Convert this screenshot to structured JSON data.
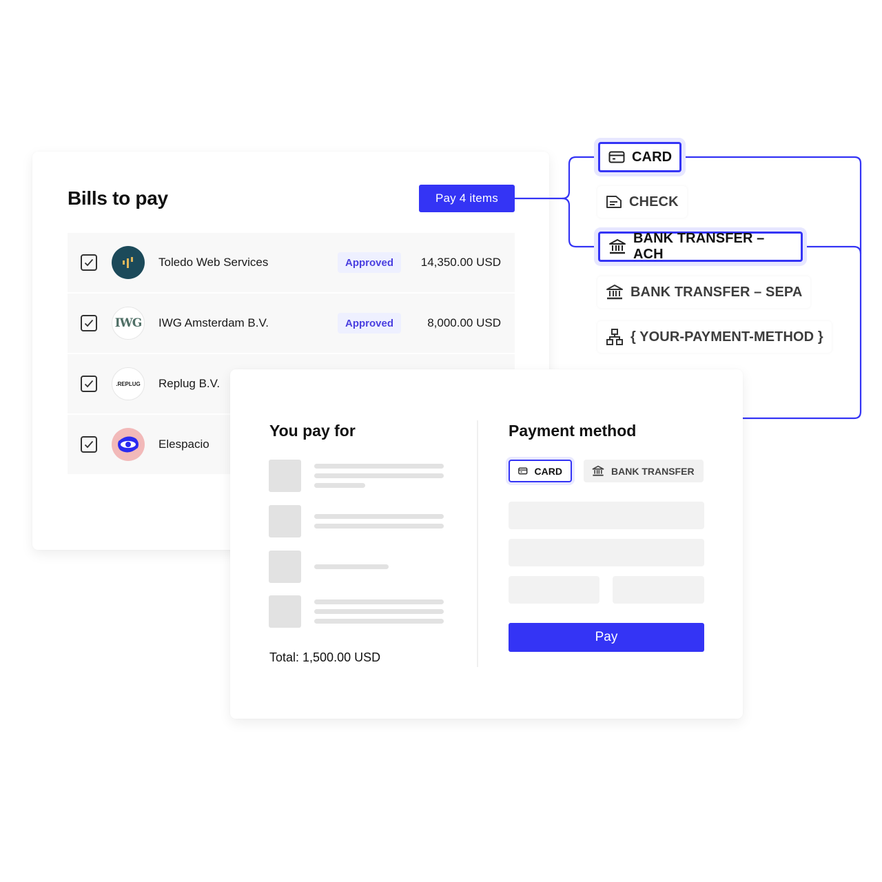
{
  "colors": {
    "accent": "#3434f5",
    "badge_bg": "#eef0ff",
    "badge_text": "#4a3fe0"
  },
  "bills": {
    "title": "Bills to pay",
    "pay_button_label": "Pay 4 items",
    "rows": [
      {
        "vendor": "Toledo Web Services",
        "status": "Approved",
        "amount": "14,350.00 USD",
        "checked": true,
        "logo": "toledo-logo"
      },
      {
        "vendor": "IWG Amsterdam B.V.",
        "status": "Approved",
        "amount": "8,000.00 USD",
        "checked": true,
        "logo": "iwg-logo",
        "logo_text": "IWG"
      },
      {
        "vendor": "Replug B.V.",
        "checked": true,
        "logo": "replug-logo",
        "logo_text": ".REPLUG"
      },
      {
        "vendor": "Elespacio",
        "checked": true,
        "logo": "elespacio-logo"
      }
    ]
  },
  "payment_methods": [
    {
      "label": "CARD",
      "icon": "credit-card-icon",
      "active": true
    },
    {
      "label": "CHECK",
      "icon": "check-document-icon",
      "active": false
    },
    {
      "label": "BANK TRANSFER – ACH",
      "icon": "bank-icon",
      "active": true
    },
    {
      "label": "BANK TRANSFER – SEPA",
      "icon": "bank-icon",
      "active": false
    },
    {
      "label": "{ YOUR-PAYMENT-METHOD }",
      "icon": "hierarchy-icon",
      "active": false
    }
  ],
  "checkout": {
    "you_pay_for_title": "You pay for",
    "total": "Total: 1,500.00 USD",
    "payment_method_title": "Payment method",
    "tabs": [
      {
        "label": "CARD",
        "icon": "credit-card-icon",
        "selected": true
      },
      {
        "label": "BANK TRANSFER",
        "icon": "bank-icon",
        "selected": false
      }
    ],
    "pay_button_label": "Pay"
  }
}
